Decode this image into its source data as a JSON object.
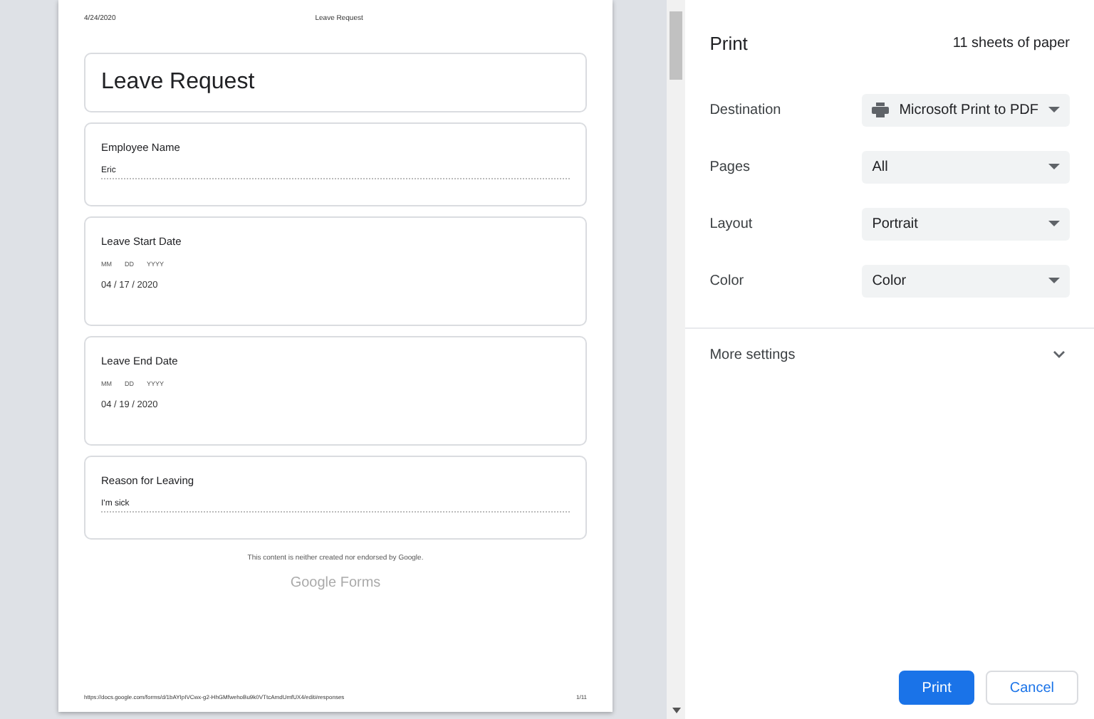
{
  "preview": {
    "header_date": "4/24/2020",
    "header_title": "Leave Request",
    "form_title": "Leave Request",
    "questions": [
      {
        "kind": "text",
        "label": "Employee Name",
        "value": "Eric"
      },
      {
        "kind": "date",
        "label": "Leave Start Date",
        "parts": [
          "MM",
          "DD",
          "YYYY"
        ],
        "value": "04 / 17 / 2020"
      },
      {
        "kind": "date",
        "label": "Leave End Date",
        "parts": [
          "MM",
          "DD",
          "YYYY"
        ],
        "value": "04 / 19 / 2020"
      },
      {
        "kind": "text",
        "label": "Reason for Leaving",
        "value": "I'm sick"
      }
    ],
    "disclaimer": "This content is neither created nor endorsed by Google.",
    "brand": "Google Forms",
    "footer_url": "https://docs.google.com/forms/d/1bAYIpIVCwx-g2-HhGMfwehoBu9k0VTtcAmdUmfUX4/edit#responses",
    "footer_page": "1/11"
  },
  "print_panel": {
    "title": "Print",
    "sheets": "11 sheets of paper",
    "settings": [
      {
        "label": "Destination",
        "value": "Microsoft Print to PDF",
        "kind": "printer"
      },
      {
        "label": "Pages",
        "value": "All",
        "kind": "plain"
      },
      {
        "label": "Layout",
        "value": "Portrait",
        "kind": "plain"
      },
      {
        "label": "Color",
        "value": "Color",
        "kind": "plain"
      }
    ],
    "more_settings": {
      "label": "More settings",
      "expanded": false
    },
    "buttons": [
      {
        "label": "Print",
        "kind": "primary"
      },
      {
        "label": "Cancel",
        "kind": "secondary"
      }
    ]
  }
}
